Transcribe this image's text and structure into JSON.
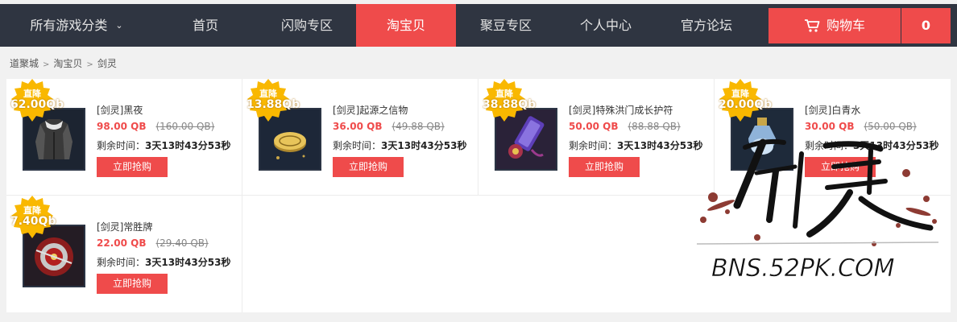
{
  "nav": {
    "items": [
      {
        "label": "所有游戏分类",
        "dropdown": true
      },
      {
        "label": "首页"
      },
      {
        "label": "闪购专区"
      },
      {
        "label": "淘宝贝",
        "active": true
      },
      {
        "label": "聚豆专区"
      },
      {
        "label": "个人中心"
      },
      {
        "label": "官方论坛"
      }
    ],
    "cart_label": "购物车",
    "cart_count": "0"
  },
  "breadcrumb": [
    "道聚城",
    "淘宝贝",
    "剑灵"
  ],
  "products": [
    {
      "badge_label": "直降",
      "badge_amount": "62.00Qb",
      "name": "[剑灵]黑夜",
      "price": "98.00 QB",
      "old_price": "(160.00 QB)",
      "timer_label": "剩余时间：",
      "timer_value": "3天13时43分53秒",
      "button": "立即抢购",
      "icon": "jacket-icon"
    },
    {
      "badge_label": "直降",
      "badge_amount": "13.88Qb",
      "name": "[剑灵]起源之信物",
      "price": "36.00 QB",
      "old_price": "(49.88 QB)",
      "timer_label": "剩余时间：",
      "timer_value": "3天13时43分53秒",
      "button": "立即抢购",
      "icon": "coin-icon"
    },
    {
      "badge_label": "直降",
      "badge_amount": "38.88Qb",
      "name": "[剑灵]特殊洪门成长护符",
      "price": "50.00 QB",
      "old_price": "(88.88 QB)",
      "timer_label": "剩余时间：",
      "timer_value": "3天13时43分53秒",
      "button": "立即抢购",
      "icon": "talisman-icon"
    },
    {
      "badge_label": "直降",
      "badge_amount": "20.00Qb",
      "name": "[剑灵]白青水",
      "price": "30.00 QB",
      "old_price": "(50.00 QB)",
      "timer_label": "剩余时间：",
      "timer_value": "3天13时43分53秒",
      "button": "立即抢购",
      "icon": "potion-icon"
    },
    {
      "badge_label": "直降",
      "badge_amount": "7.40Qb",
      "name": "[剑灵]常胜牌",
      "price": "22.00 QB",
      "old_price": "(29.40 QB)",
      "timer_label": "剩余时间：",
      "timer_value": "3天13时43分53秒",
      "button": "立即抢购",
      "icon": "medal-icon"
    }
  ],
  "watermark": {
    "logo_text": "剑灵",
    "site": "BNS.52PK.COM"
  },
  "colors": {
    "nav_bg": "#2f3541",
    "accent": "#ef4b4b",
    "badge": "#f9b800"
  }
}
